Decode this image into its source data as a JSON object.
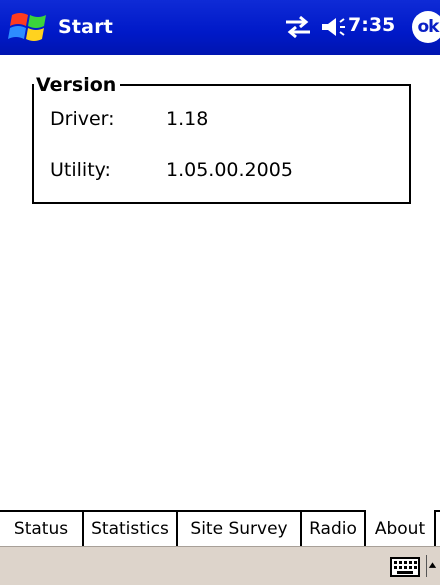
{
  "titlebar": {
    "app_title": "Start",
    "time": "7:35",
    "ok_label": "ok",
    "icons": [
      "windows-flag-icon",
      "connectivity-icon",
      "volume-icon"
    ]
  },
  "version_group": {
    "legend": "Version",
    "rows": [
      {
        "label": "Driver:",
        "value": "1.18"
      },
      {
        "label": "Utility:",
        "value": "1.05.00.2005"
      }
    ]
  },
  "tabs": [
    {
      "label": "Status",
      "active": false
    },
    {
      "label": "Statistics",
      "active": false
    },
    {
      "label": "Site Survey",
      "active": false
    },
    {
      "label": "Radio",
      "active": false
    },
    {
      "label": "About",
      "active": true
    }
  ],
  "cmdbar": {
    "icons": [
      "keyboard-icon",
      "sip-up-arrow-icon"
    ],
    "background": "#ddd4cb"
  },
  "colors": {
    "titlebar": "#0019c8",
    "text": "#000000"
  }
}
